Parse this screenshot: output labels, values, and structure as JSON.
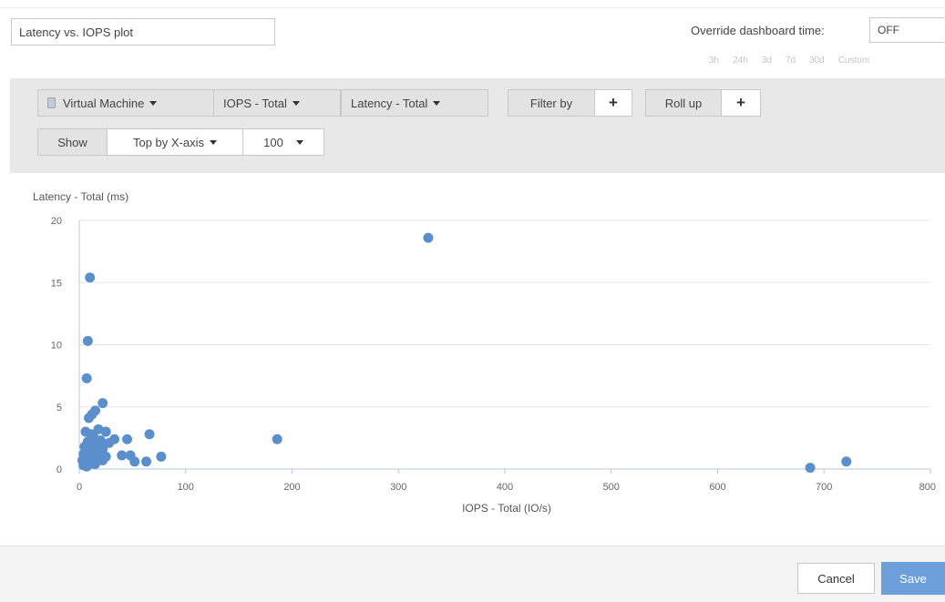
{
  "widget": {
    "title_value": "Latency vs. IOPS plot",
    "override_label": "Override dashboard time:",
    "override_value": "OFF",
    "time_ranges": [
      "3h",
      "24h",
      "3d",
      "7d",
      "30d",
      "Custom"
    ]
  },
  "toolbar": {
    "object_type": "Virtual Machine",
    "x_metric": "IOPS - Total",
    "y_metric": "Latency - Total",
    "filter_by": "Filter by",
    "filter_add": "+",
    "roll_up": "Roll up",
    "roll_up_add": "+",
    "show": "Show",
    "sort_mode": "Top by X-axis",
    "count": "100"
  },
  "chart_data": {
    "type": "scatter",
    "xlabel": "IOPS - Total (IO/s)",
    "ylabel": "Latency - Total (ms)",
    "xlim": [
      0,
      800
    ],
    "ylim": [
      0,
      20
    ],
    "x_ticks": [
      0,
      100,
      200,
      300,
      400,
      500,
      600,
      700,
      800
    ],
    "y_ticks": [
      0,
      5,
      10,
      15,
      20
    ],
    "grid": true,
    "color": "#5b8fcb",
    "points": [
      [
        328,
        18.6
      ],
      [
        10,
        15.4
      ],
      [
        8,
        10.3
      ],
      [
        7,
        7.3
      ],
      [
        22,
        5.3
      ],
      [
        15,
        4.7
      ],
      [
        12,
        4.4
      ],
      [
        9,
        4.1
      ],
      [
        18,
        3.2
      ],
      [
        6,
        3.0
      ],
      [
        25,
        3.0
      ],
      [
        11,
        2.8
      ],
      [
        66,
        2.8
      ],
      [
        14,
        2.5
      ],
      [
        186,
        2.4
      ],
      [
        33,
        2.4
      ],
      [
        45,
        2.4
      ],
      [
        20,
        2.3
      ],
      [
        8,
        2.2
      ],
      [
        28,
        2.1
      ],
      [
        12,
        1.9
      ],
      [
        5,
        1.8
      ],
      [
        16,
        1.7
      ],
      [
        22,
        1.6
      ],
      [
        7,
        1.5
      ],
      [
        10,
        1.4
      ],
      [
        14,
        1.3
      ],
      [
        4,
        1.2
      ],
      [
        19,
        1.2
      ],
      [
        40,
        1.1
      ],
      [
        48,
        1.1
      ],
      [
        9,
        1.0
      ],
      [
        25,
        1.0
      ],
      [
        77,
        1.0
      ],
      [
        6,
        0.9
      ],
      [
        12,
        0.8
      ],
      [
        17,
        0.8
      ],
      [
        3,
        0.7
      ],
      [
        22,
        0.7
      ],
      [
        8,
        0.6
      ],
      [
        13,
        0.6
      ],
      [
        52,
        0.6
      ],
      [
        63,
        0.6
      ],
      [
        721,
        0.6
      ],
      [
        5,
        0.5
      ],
      [
        10,
        0.4
      ],
      [
        15,
        0.4
      ],
      [
        4,
        0.3
      ],
      [
        7,
        0.2
      ],
      [
        687,
        0.1
      ]
    ]
  },
  "footer": {
    "cancel": "Cancel",
    "save": "Save"
  }
}
